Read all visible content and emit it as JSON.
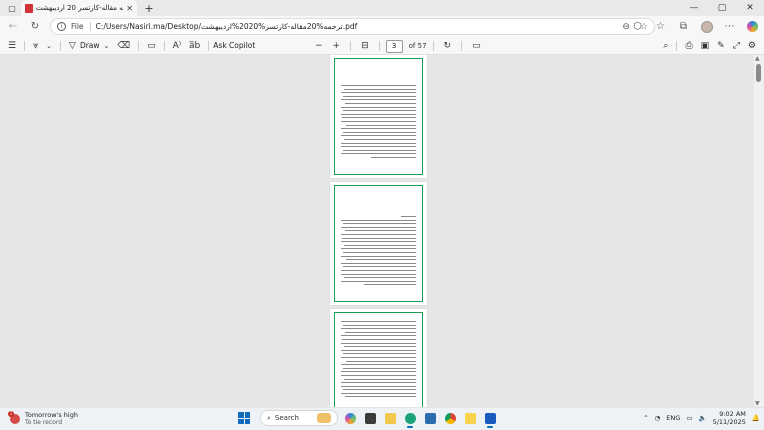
{
  "browser": {
    "tab": {
      "title": "ترجمه مقاله-کارتسر 20 اردیبهشت..."
    },
    "address": {
      "scheme_label": "File",
      "url": "C:/Users/Nasiri.ma/Desktop/ترجمه%20مقاله-کارتسر%2020%اردیبهشت.pdf"
    }
  },
  "pdf_toolbar": {
    "draw_label": "Draw",
    "ask_copilot_label": "Ask Copilot",
    "current_page": "3",
    "page_total_label": "of 57"
  },
  "viewer": {
    "page_count_visible": 3
  },
  "taskbar": {
    "weather": {
      "badge": "1",
      "title": "Tomorrow's high",
      "subtitle": "To tie record"
    },
    "search_label": "Search",
    "language": "ENG",
    "time": "9:02 AM",
    "date": "5/11/2025"
  },
  "colors": {
    "page_border": "#1a9e55",
    "pdf_icon": "#d13438",
    "accent": "#0f6cbd"
  }
}
